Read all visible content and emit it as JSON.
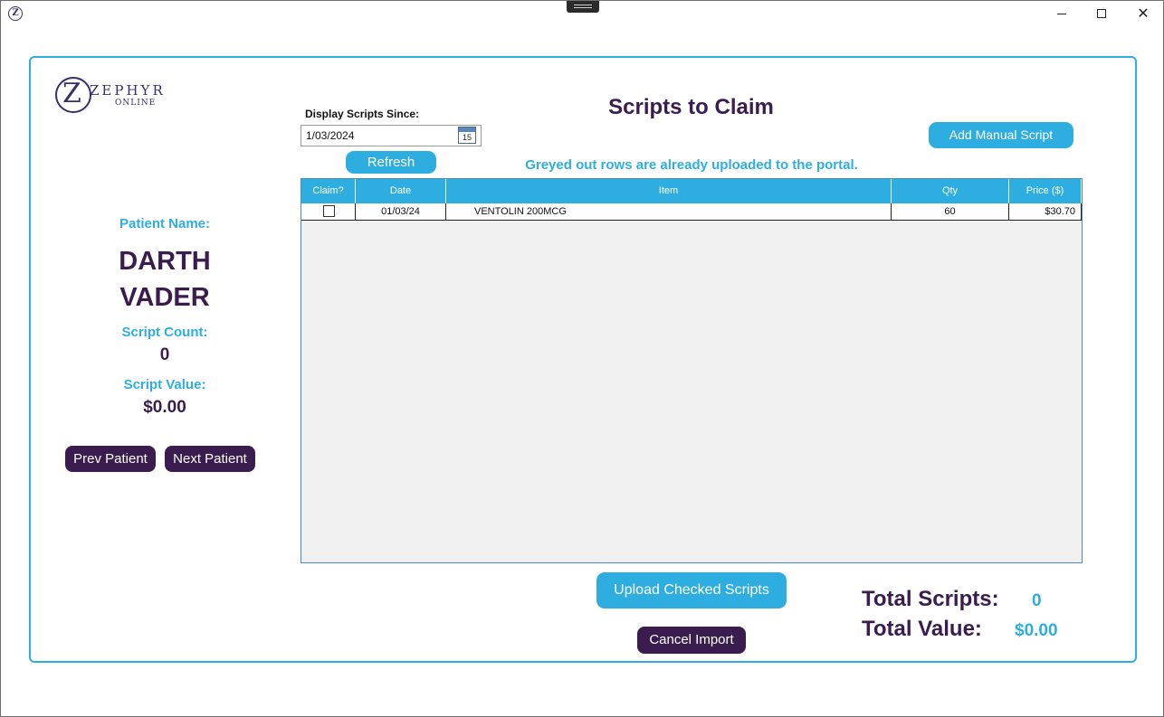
{
  "window": {
    "icon": "zephyr-app-icon",
    "controls": {
      "minimize": "minimize-icon",
      "maximize": "maximize-icon",
      "close": "✕"
    }
  },
  "logo": {
    "letter": "Z",
    "word": "ZEPHYR",
    "sub": "ONLINE"
  },
  "header": {
    "title": "Scripts to Claim",
    "since_label": "Display Scripts Since:",
    "since_value": "1/03/2024",
    "calendar_day": "15",
    "refresh_label": "Refresh",
    "add_label": "Add Manual Script",
    "notice": "Greyed out rows are already uploaded to the portal."
  },
  "patient": {
    "name_label": "Patient Name:",
    "first_name": "DARTH",
    "last_name": "VADER",
    "count_label": "Script Count:",
    "count_value": "0",
    "value_label": "Script Value:",
    "value_value": "$0.00",
    "prev_label": "Prev Patient",
    "next_label": "Next Patient"
  },
  "grid": {
    "columns": [
      "Claim?",
      "Date",
      "Item",
      "Qty",
      "Price ($)"
    ],
    "rows": [
      {
        "claimed": false,
        "date": "01/03/24",
        "item": "VENTOLIN 200MCG",
        "qty": "60",
        "price": "$30.70"
      }
    ]
  },
  "footer": {
    "upload_label": "Upload Checked Scripts",
    "cancel_label": "Cancel Import",
    "total_scripts_label": "Total Scripts:",
    "total_scripts_value": "0",
    "total_value_label": "Total Value:",
    "total_value_value": "$0.00"
  },
  "colors": {
    "accent": "#2eaee0",
    "brand": "#3a1c4f"
  }
}
